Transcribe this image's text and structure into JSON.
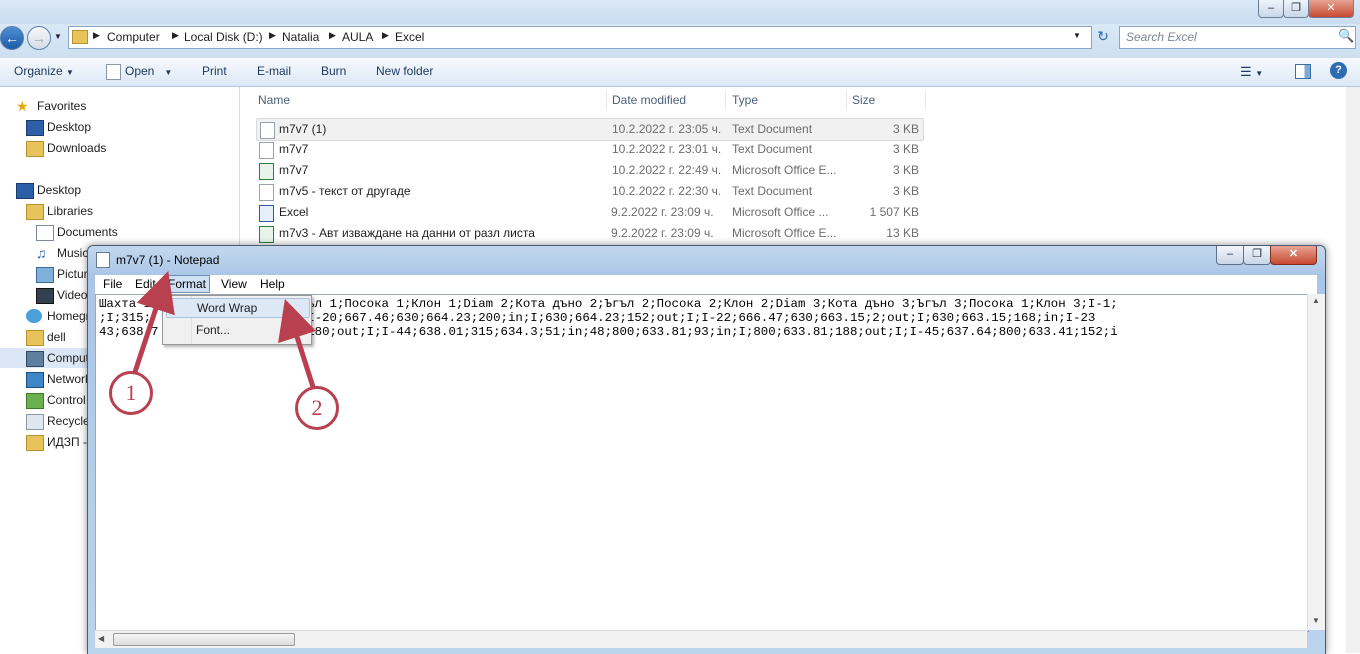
{
  "explorer": {
    "breadcrumb": [
      "Computer",
      "Local Disk (D:)",
      "Natalia",
      "AULA",
      "Excel"
    ],
    "search_placeholder": "Search Excel",
    "toolbar": {
      "organize": "Organize",
      "open": "Open",
      "print": "Print",
      "email": "E-mail",
      "burn": "Burn",
      "new_folder": "New folder"
    },
    "nav": {
      "favorites": "Favorites",
      "fav_items": [
        "Desktop",
        "Downloads"
      ],
      "desktop": "Desktop",
      "libraries": "Libraries",
      "lib_items": [
        "Documents",
        "Music",
        "Pictures",
        "Videos"
      ],
      "homegroup": "Homegroup",
      "dell": "dell",
      "computer": "Computer",
      "network": "Network",
      "control_panel": "Control Panel",
      "recycle_bin": "Recycle Bin",
      "folder": "ИДЗП - ..."
    },
    "columns": {
      "name": "Name",
      "date": "Date modified",
      "type": "Type",
      "size": "Size"
    },
    "files": [
      {
        "name": "m7v7 (1)",
        "date": "10.2.2022 г. 23:05 ч.",
        "type": "Text Document",
        "size": "3 KB",
        "icon": "text-file"
      },
      {
        "name": "m7v7",
        "date": "10.2.2022 г. 23:01 ч.",
        "type": "Text Document",
        "size": "3 KB",
        "icon": "text-file"
      },
      {
        "name": "m7v7",
        "date": "10.2.2022 г. 22:49 ч.",
        "type": "Microsoft Office E...",
        "size": "3 KB",
        "icon": "excel-file"
      },
      {
        "name": "m7v5 - текст от другаде",
        "date": "10.2.2022 г. 22:30 ч.",
        "type": "Text Document",
        "size": "3 KB",
        "icon": "text-file"
      },
      {
        "name": "Excel",
        "date": "9.2.2022 г. 23:09 ч.",
        "type": "Microsoft Office ...",
        "size": "1 507 KB",
        "icon": "word-file"
      },
      {
        "name": "m7v3 - Авт изваждане на данни от разл листа",
        "date": "9.2.2022 г. 23:09 ч.",
        "type": "Microsoft Office E...",
        "size": "13 KB",
        "icon": "excel-file"
      }
    ]
  },
  "notepad": {
    "title": "m7v7 (1) - Notepad",
    "menu": [
      "File",
      "Edit",
      "Format",
      "View",
      "Help"
    ],
    "lines": [
      "Шахта 1      ;Кота дъно 1;Ъгъл 1;Посока 1;Клон 1;Diam 2;Кота дъно 2;Ъгъл 2;Посока 2;Клон 2;Diam 3;Кота дъно 3;Ъгъл 3;Посока 1;Клон 3;I-1;",
      ";I;315;     ;664.64;49;in;I;I-20;667.46;630;664.23;200;in;I;630;664.23;152;out;I;I-22;666.47;630;663.15;2;out;I;630;663.15;168;in;I-23",
      "43;638.7      ;I;800;634.39;180;out;I;I-44;638.01;315;634.3;51;in;48;800;633.81;93;in;I;800;633.81;188;out;I;I-45;637.64;800;633.41;152;i"
    ],
    "format_menu": [
      "Word Wrap",
      "Font..."
    ]
  },
  "callouts": [
    "1",
    "2"
  ],
  "colors": {
    "callout": "#b9404f",
    "accent": "#3a74c1"
  }
}
